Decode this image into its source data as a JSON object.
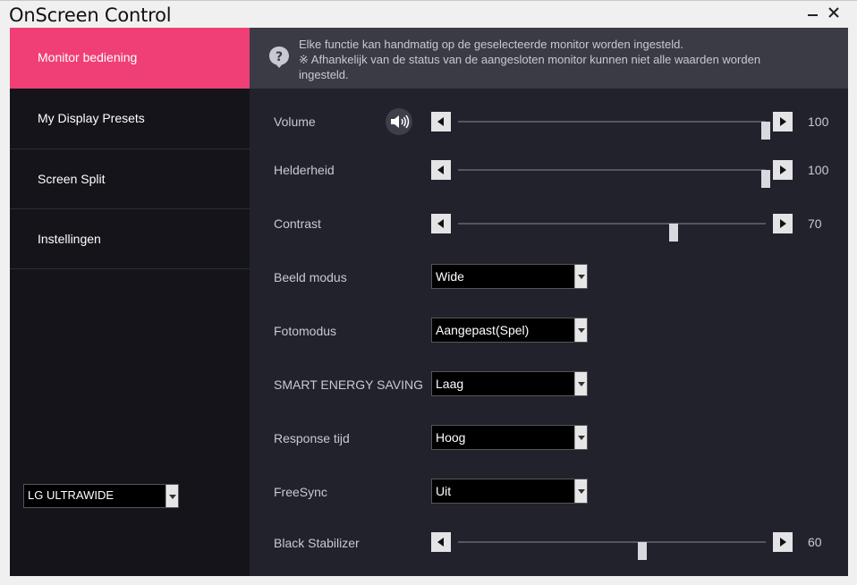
{
  "window": {
    "title": "OnScreen Control"
  },
  "sidebar": {
    "items": [
      {
        "label": "Monitor bediening",
        "active": true
      },
      {
        "label": "My Display Presets",
        "active": false
      },
      {
        "label": "Screen Split",
        "active": false
      },
      {
        "label": "Instellingen",
        "active": false
      }
    ],
    "monitor_select": {
      "value": "LG ULTRAWIDE"
    }
  },
  "info": {
    "line1": "Elke functie kan handmatig op de geselecteerde monitor worden ingesteld.",
    "line2": "※ Afhankelijk van de status van de aangesloten monitor kunnen niet  alle waarden worden",
    "line3": "ingesteld."
  },
  "settings": {
    "volume": {
      "label": "Volume",
      "value": "100",
      "level": 100
    },
    "brightness": {
      "label": "Helderheid",
      "value": "100",
      "level": 100
    },
    "contrast": {
      "label": "Contrast",
      "value": "70",
      "level": 70
    },
    "picture_mode": {
      "label": "Beeld modus",
      "value": "Wide"
    },
    "photo_mode": {
      "label": "Fotomodus",
      "value": "Aangepast(Spel)"
    },
    "smart_energy": {
      "label": "SMART ENERGY SAVING",
      "value": "Laag"
    },
    "response_time": {
      "label": "Response tijd",
      "value": "Hoog"
    },
    "freesync": {
      "label": "FreeSync",
      "value": "Uit"
    },
    "black_stabilizer": {
      "label": "Black Stabilizer",
      "value": "60",
      "level": 60
    }
  },
  "colors": {
    "accent": "#ef3f76",
    "sidebar_bg": "#14141a",
    "main_bg": "#22222d",
    "info_bg": "#3b3b45"
  },
  "icons": [
    "help-icon",
    "speaker-icon",
    "close-icon",
    "minimize-icon"
  ]
}
